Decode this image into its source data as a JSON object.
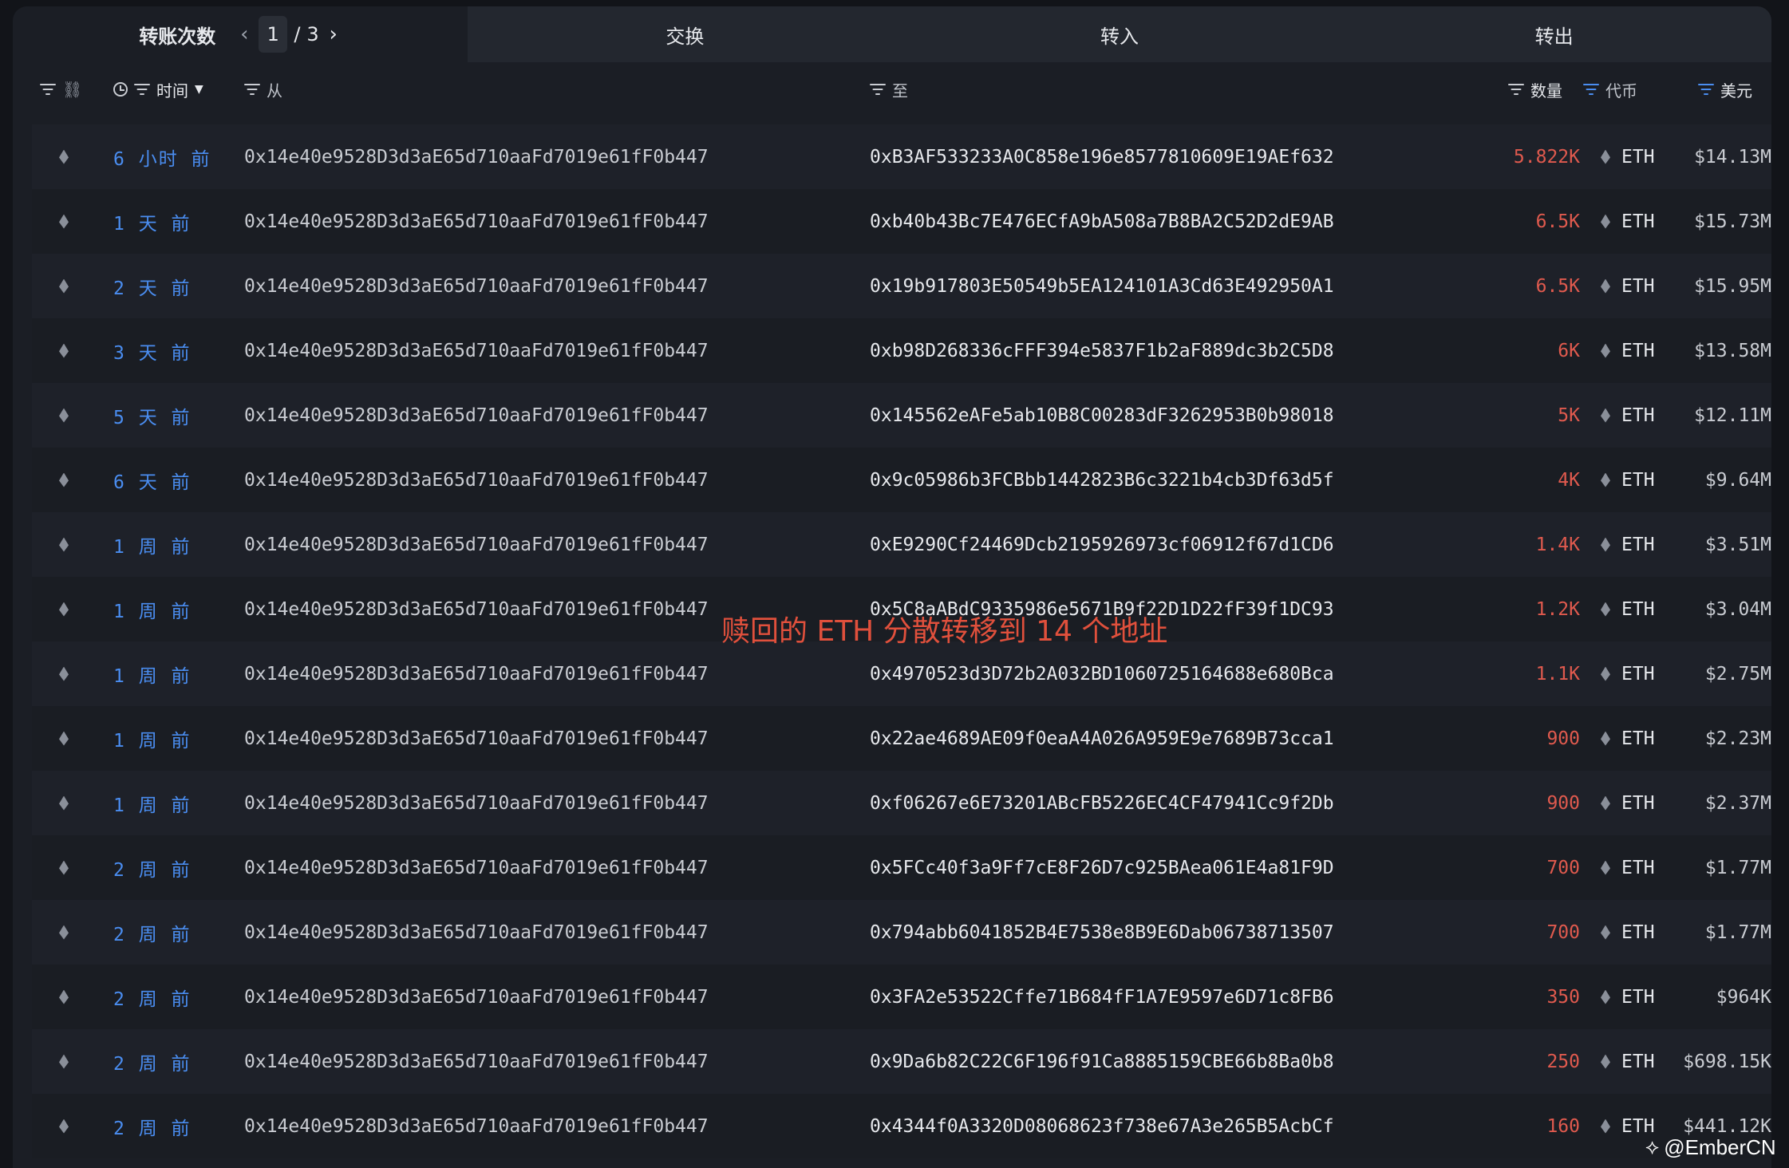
{
  "tabs": {
    "transfers_label": "转账次数",
    "page_current": "1",
    "page_separator": "/",
    "page_total": "3",
    "swap_label": "交换",
    "in_label": "转入",
    "out_label": "转出"
  },
  "header": {
    "time": "时间",
    "from": "从",
    "to": "至",
    "quantity": "数量",
    "token": "代币",
    "usd": "美元"
  },
  "rows": [
    {
      "time": "6 小时 前",
      "from": "0x14e40e9528D3d3aE65d710aaFd7019e61fF0b447",
      "to": "0xB3AF533233A0C858e196e8577810609E19AEf632",
      "qty": "5.822K",
      "token": "ETH",
      "usd": "$14.13M"
    },
    {
      "time": "1 天 前",
      "from": "0x14e40e9528D3d3aE65d710aaFd7019e61fF0b447",
      "to": "0xb40b43Bc7E476ECfA9bA508a7B8BA2C52D2dE9AB",
      "qty": "6.5K",
      "token": "ETH",
      "usd": "$15.73M"
    },
    {
      "time": "2 天 前",
      "from": "0x14e40e9528D3d3aE65d710aaFd7019e61fF0b447",
      "to": "0x19b917803E50549b5EA124101A3Cd63E492950A1",
      "qty": "6.5K",
      "token": "ETH",
      "usd": "$15.95M"
    },
    {
      "time": "3 天 前",
      "from": "0x14e40e9528D3d3aE65d710aaFd7019e61fF0b447",
      "to": "0xb98D268336cFFF394e5837F1b2aF889dc3b2C5D8",
      "qty": "6K",
      "token": "ETH",
      "usd": "$13.58M"
    },
    {
      "time": "5 天 前",
      "from": "0x14e40e9528D3d3aE65d710aaFd7019e61fF0b447",
      "to": "0x145562eAFe5ab10B8C00283dF3262953B0b98018",
      "qty": "5K",
      "token": "ETH",
      "usd": "$12.11M"
    },
    {
      "time": "6 天 前",
      "from": "0x14e40e9528D3d3aE65d710aaFd7019e61fF0b447",
      "to": "0x9c05986b3FCBbb1442823B6c3221b4cb3Df63d5f",
      "qty": "4K",
      "token": "ETH",
      "usd": "$9.64M"
    },
    {
      "time": "1 周 前",
      "from": "0x14e40e9528D3d3aE65d710aaFd7019e61fF0b447",
      "to": "0xE9290Cf24469Dcb2195926973cf06912f67d1CD6",
      "qty": "1.4K",
      "token": "ETH",
      "usd": "$3.51M"
    },
    {
      "time": "1 周 前",
      "from": "0x14e40e9528D3d3aE65d710aaFd7019e61fF0b447",
      "to": "0x5C8aABdC9335986e5671B9f22D1D22fF39f1DC93",
      "qty": "1.2K",
      "token": "ETH",
      "usd": "$3.04M"
    },
    {
      "time": "1 周 前",
      "from": "0x14e40e9528D3d3aE65d710aaFd7019e61fF0b447",
      "to": "0x4970523d3D72b2A032BD1060725164688e680Bca",
      "qty": "1.1K",
      "token": "ETH",
      "usd": "$2.75M"
    },
    {
      "time": "1 周 前",
      "from": "0x14e40e9528D3d3aE65d710aaFd7019e61fF0b447",
      "to": "0x22ae4689AE09f0eaA4A026A959E9e7689B73cca1",
      "qty": "900",
      "token": "ETH",
      "usd": "$2.23M"
    },
    {
      "time": "1 周 前",
      "from": "0x14e40e9528D3d3aE65d710aaFd7019e61fF0b447",
      "to": "0xf06267e6E73201ABcFB5226EC4CF47941Cc9f2Db",
      "qty": "900",
      "token": "ETH",
      "usd": "$2.37M"
    },
    {
      "time": "2 周 前",
      "from": "0x14e40e9528D3d3aE65d710aaFd7019e61fF0b447",
      "to": "0x5FCc40f3a9Ff7cE8F26D7c925BAea061E4a81F9D",
      "qty": "700",
      "token": "ETH",
      "usd": "$1.77M"
    },
    {
      "time": "2 周 前",
      "from": "0x14e40e9528D3d3aE65d710aaFd7019e61fF0b447",
      "to": "0x794abb6041852B4E7538e8B9E6Dab06738713507",
      "qty": "700",
      "token": "ETH",
      "usd": "$1.77M"
    },
    {
      "time": "2 周 前",
      "from": "0x14e40e9528D3d3aE65d710aaFd7019e61fF0b447",
      "to": "0x3FA2e53522Cffe71B684fF1A7E9597e6D71c8FB6",
      "qty": "350",
      "token": "ETH",
      "usd": "$964K"
    },
    {
      "time": "2 周 前",
      "from": "0x14e40e9528D3d3aE65d710aaFd7019e61fF0b447",
      "to": "0x9Da6b82C22C6F196f91Ca8885159CBE66b8Ba0b8",
      "qty": "250",
      "token": "ETH",
      "usd": "$698.15K"
    },
    {
      "time": "2 周 前",
      "from": "0x14e40e9528D3d3aE65d710aaFd7019e61fF0b447",
      "to": "0x4344f0A3320D08068623f738e67A3e265B5AcbCf",
      "qty": "160",
      "token": "ETH",
      "usd": "$441.12K"
    }
  ],
  "annotation": "赎回的 ETH 分散转移到 14 个地址",
  "watermark": "@EmberCN",
  "colors": {
    "background": "#1b1e25",
    "time_link": "#4a8df0",
    "quantity": "#e05a4e",
    "annotation": "#e0503c"
  },
  "icons": {
    "chain": "ethereum-icon",
    "filter": "filter-icon",
    "link": "link-icon",
    "clock": "clock-icon"
  }
}
